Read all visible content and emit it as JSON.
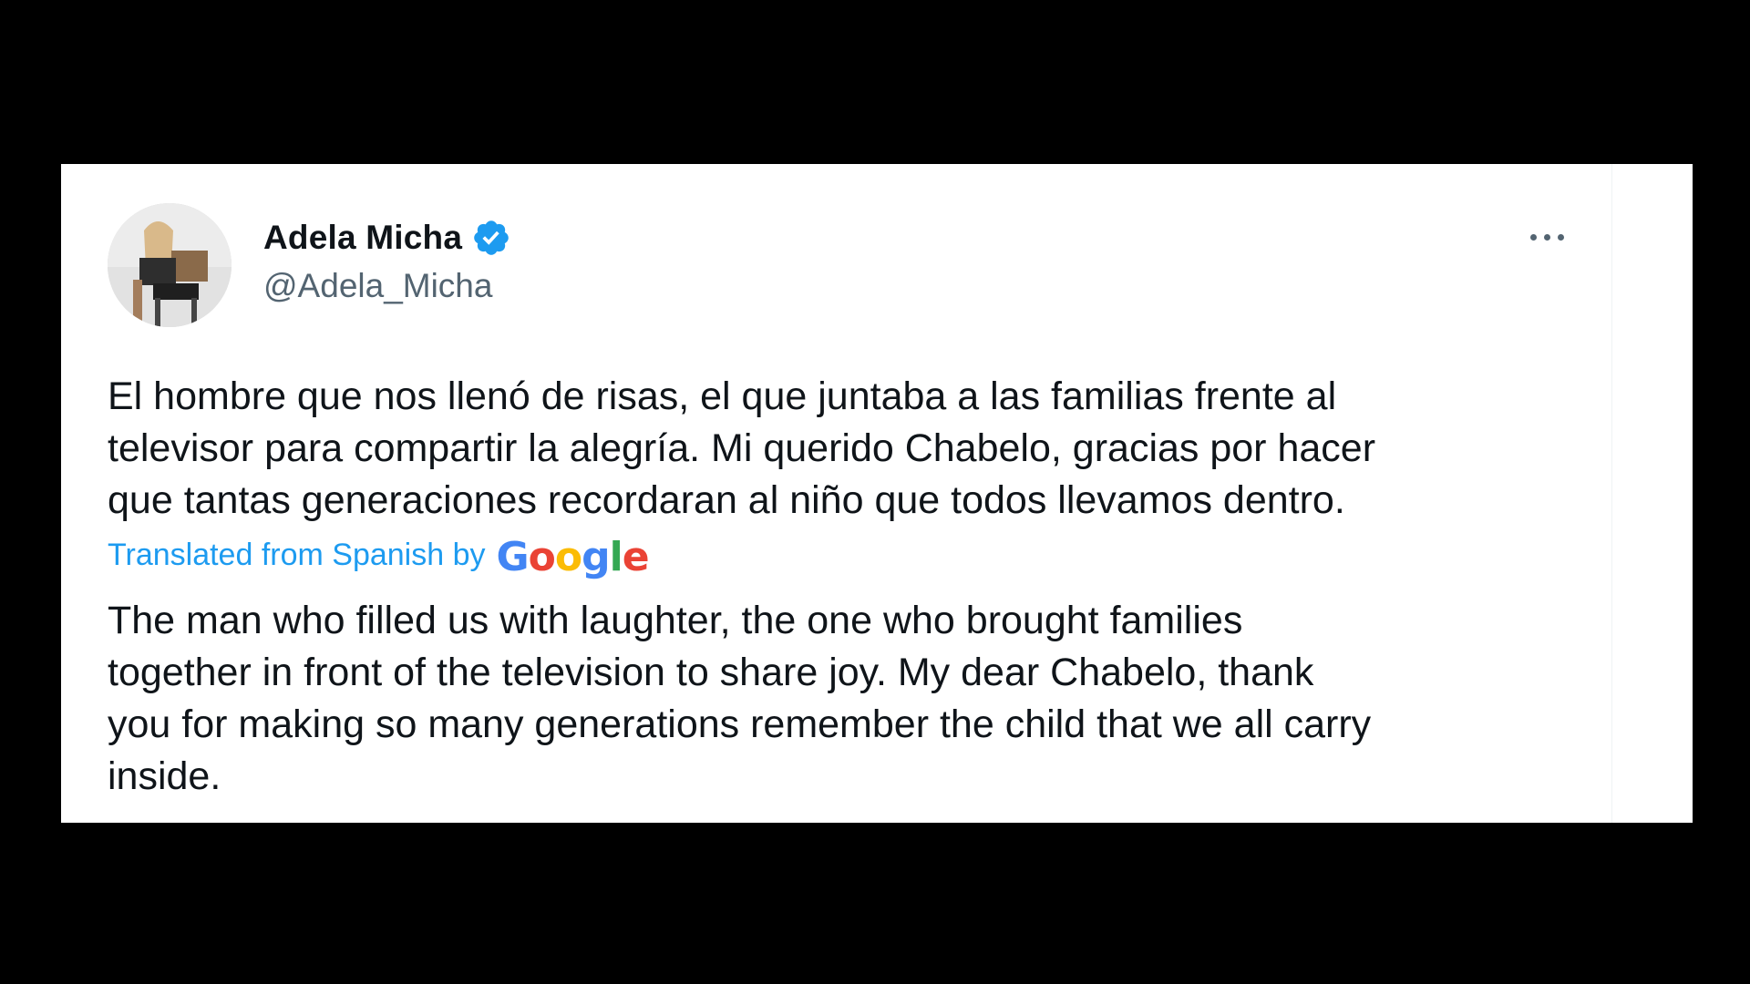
{
  "tweet": {
    "author": {
      "display_name": "Adela Micha",
      "handle": "@Adela_Micha",
      "verified": true
    },
    "original_text": "El hombre que nos llenó de risas, el que juntaba a las familias frente al\ntelevisor para compartir la alegría. Mi querido Chabelo, gracias por hacer\nque tantas generaciones recordaran al niño que todos llevamos dentro.",
    "translation_label": "Translated from Spanish by",
    "translation_provider": {
      "letters": [
        "G",
        "o",
        "o",
        "g",
        "l",
        "e"
      ],
      "colors": [
        "#4285F4",
        "#EA4335",
        "#FBBC05",
        "#4285F4",
        "#34A853",
        "#EA4335"
      ]
    },
    "translated_text": "The man who filled us with laughter, the one who brought families\ntogether in front of the television to share joy. My dear Chabelo, thank\nyou for making so many generations remember the child that we all carry\ninside.",
    "icons": {
      "verified": "verified-badge-icon",
      "more": "more-options-icon"
    },
    "colors": {
      "accent": "#1d9bf0",
      "text": "#0f1419",
      "muted": "#536471"
    }
  }
}
